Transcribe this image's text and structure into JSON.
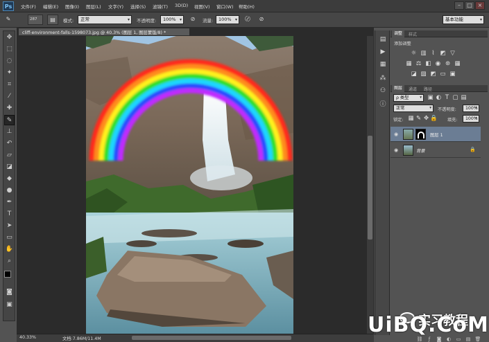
{
  "app": {
    "logo": "Ps"
  },
  "menu": [
    "文件(F)",
    "编辑(E)",
    "图像(I)",
    "图层(L)",
    "文字(Y)",
    "选择(S)",
    "滤镜(T)",
    "3D(D)",
    "视图(V)",
    "窗口(W)",
    "帮助(H)"
  ],
  "window_buttons": [
    "–",
    "□",
    "×"
  ],
  "options": {
    "brush_size": "287",
    "mode_label": "模式:",
    "mode_value": "正常",
    "opacity_label": "不透明度:",
    "opacity_value": "100%",
    "flow_label": "流量:",
    "flow_value": "100%",
    "workspace": "基本功能"
  },
  "document": {
    "tab_title": "cliff-environment-falls-1598073.jpg @ 40.3% (图层 1, 图层蒙版/8) *",
    "zoom": "40.33%",
    "doc_info": "文档:7.86M/11.4M"
  },
  "panels": {
    "adjustments_tab": "调整",
    "styles_tab": "样式",
    "adjust_title": "添加调整",
    "layers_tab": "图层",
    "channels_tab": "通道",
    "paths_tab": "路径",
    "filter_kind": "ρ 类型",
    "blend_mode": "正常",
    "opacity_label": "不透明度:",
    "opacity_value": "100%",
    "lock_label": "锁定:",
    "fill_label": "填充:",
    "fill_value": "100%",
    "layers": [
      {
        "name": "图层 1"
      },
      {
        "name": "背景"
      }
    ]
  },
  "watermark": {
    "brand": "UiBQ.CoM",
    "text": "实习教程"
  }
}
